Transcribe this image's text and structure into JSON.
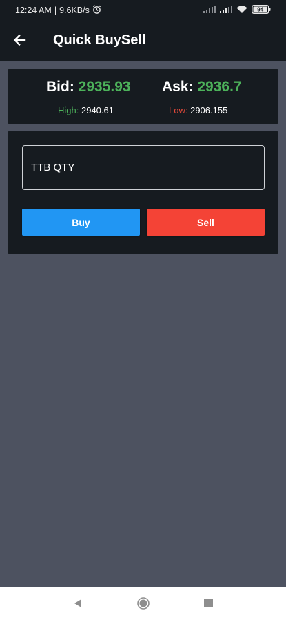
{
  "status_bar": {
    "time": "12:24 AM",
    "separator": "|",
    "speed": "9.6KB/s",
    "battery": "94",
    "icons": [
      "alarm-icon",
      "signal-icon",
      "signal-icon",
      "wifi-icon",
      "battery-icon"
    ]
  },
  "app_bar": {
    "title": "Quick BuySell",
    "back_icon": "arrow-left-icon"
  },
  "quote": {
    "bid_label": "Bid:",
    "bid_value": "2935.93",
    "ask_label": "Ask:",
    "ask_value": "2936.7",
    "high_label": "High:",
    "high_value": "2940.61",
    "low_label": "Low:",
    "low_value": "2906.155"
  },
  "order": {
    "qty_placeholder": "TTB QTY",
    "buy_label": "Buy",
    "sell_label": "Sell"
  },
  "colors": {
    "accent_green": "#4cb15a",
    "accent_red": "#e5493a",
    "buy_blue": "#2196f3",
    "sell_red": "#f44336",
    "card_bg": "#161b20",
    "page_bg": "#4d5260"
  },
  "nav_bar": {
    "icons": [
      "nav-back-icon",
      "nav-home-icon",
      "nav-recents-icon"
    ]
  }
}
